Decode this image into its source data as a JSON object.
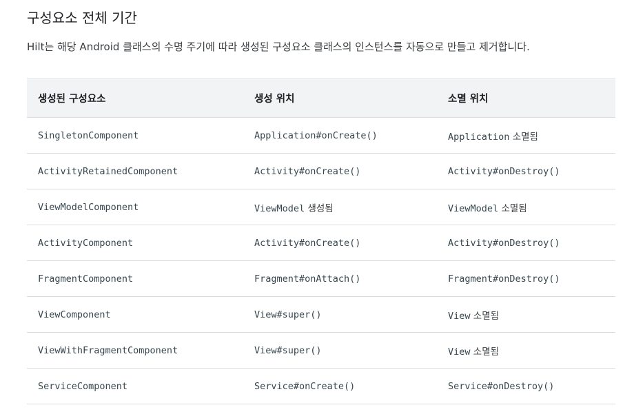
{
  "section": {
    "title": "구성요소 전체 기간",
    "description": "Hilt는 해당 Android 클래스의 수명 주기에 따라 생성된 구성요소 클래스의 인스턴스를 자동으로 만들고 제거합니다."
  },
  "table": {
    "headers": [
      "생성된 구성요소",
      "생성 위치",
      "소멸 위치"
    ],
    "rows": [
      {
        "component": "SingletonComponent",
        "created": {
          "code": "Application#onCreate()",
          "text": ""
        },
        "destroyed": {
          "code": "Application",
          "text": " 소멸됨"
        }
      },
      {
        "component": "ActivityRetainedComponent",
        "created": {
          "code": "Activity#onCreate()",
          "text": ""
        },
        "destroyed": {
          "code": "Activity#onDestroy()",
          "text": ""
        }
      },
      {
        "component": "ViewModelComponent",
        "created": {
          "code": "ViewModel",
          "text": " 생성됨"
        },
        "destroyed": {
          "code": "ViewModel",
          "text": " 소멸됨"
        }
      },
      {
        "component": "ActivityComponent",
        "created": {
          "code": "Activity#onCreate()",
          "text": ""
        },
        "destroyed": {
          "code": "Activity#onDestroy()",
          "text": ""
        }
      },
      {
        "component": "FragmentComponent",
        "created": {
          "code": "Fragment#onAttach()",
          "text": ""
        },
        "destroyed": {
          "code": "Fragment#onDestroy()",
          "text": ""
        }
      },
      {
        "component": "ViewComponent",
        "created": {
          "code": "View#super()",
          "text": ""
        },
        "destroyed": {
          "code": "View",
          "text": " 소멸됨"
        }
      },
      {
        "component": "ViewWithFragmentComponent",
        "created": {
          "code": "View#super()",
          "text": ""
        },
        "destroyed": {
          "code": "View",
          "text": " 소멸됨"
        }
      },
      {
        "component": "ServiceComponent",
        "created": {
          "code": "Service#onCreate()",
          "text": ""
        },
        "destroyed": {
          "code": "Service#onDestroy()",
          "text": ""
        }
      }
    ]
  }
}
